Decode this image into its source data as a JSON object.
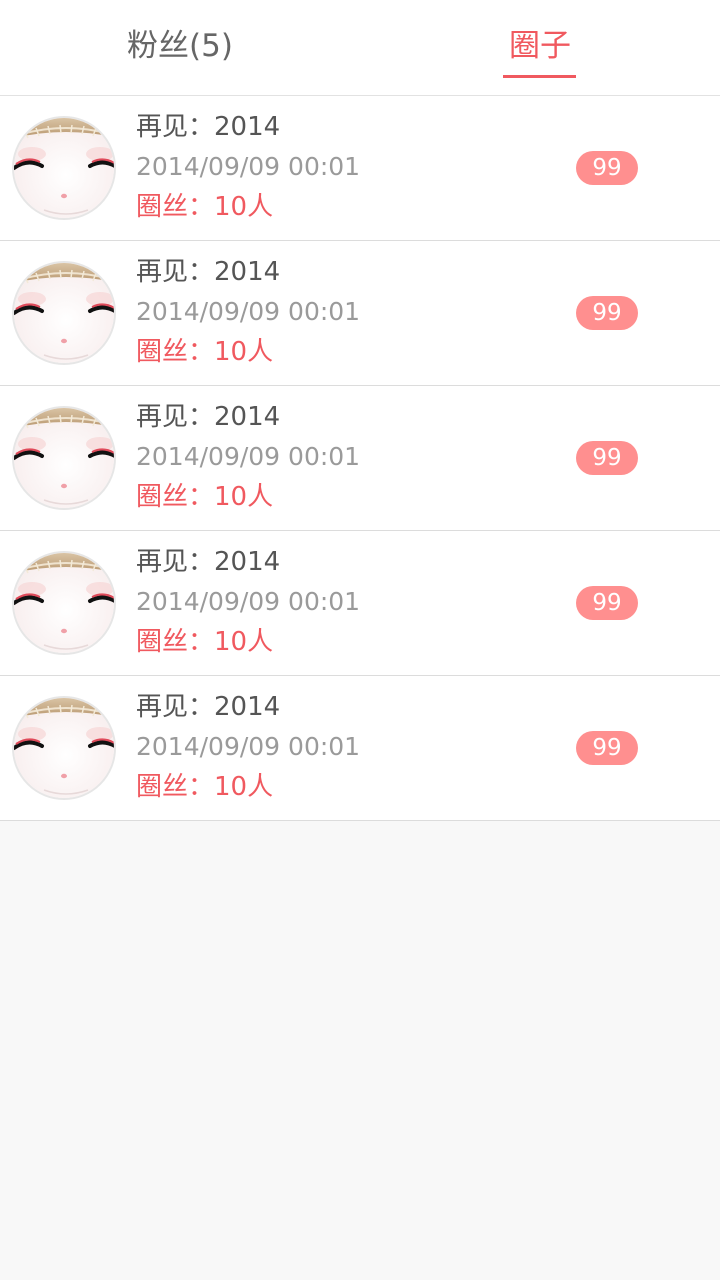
{
  "tabs": [
    {
      "label": "粉丝(5)",
      "active": false
    },
    {
      "label": "圈子",
      "active": true
    }
  ],
  "colors": {
    "accent": "#f0595f",
    "badge": "#ff8f8f",
    "background": "#f8f8f8"
  },
  "circles": [
    {
      "title": "再见：2014",
      "time": "2014/09/09 00:01",
      "members": "圈丝：10人",
      "badge": "99",
      "avatar": "avatar-face-icon"
    },
    {
      "title": "再见：2014",
      "time": "2014/09/09 00:01",
      "members": "圈丝：10人",
      "badge": "99",
      "avatar": "avatar-face-icon"
    },
    {
      "title": "再见：2014",
      "time": "2014/09/09 00:01",
      "members": "圈丝：10人",
      "badge": "99",
      "avatar": "avatar-face-icon"
    },
    {
      "title": "再见：2014",
      "time": "2014/09/09 00:01",
      "members": "圈丝：10人",
      "badge": "99",
      "avatar": "avatar-face-icon"
    },
    {
      "title": "再见：2014",
      "time": "2014/09/09 00:01",
      "members": "圈丝：10人",
      "badge": "99",
      "avatar": "avatar-face-icon"
    }
  ]
}
